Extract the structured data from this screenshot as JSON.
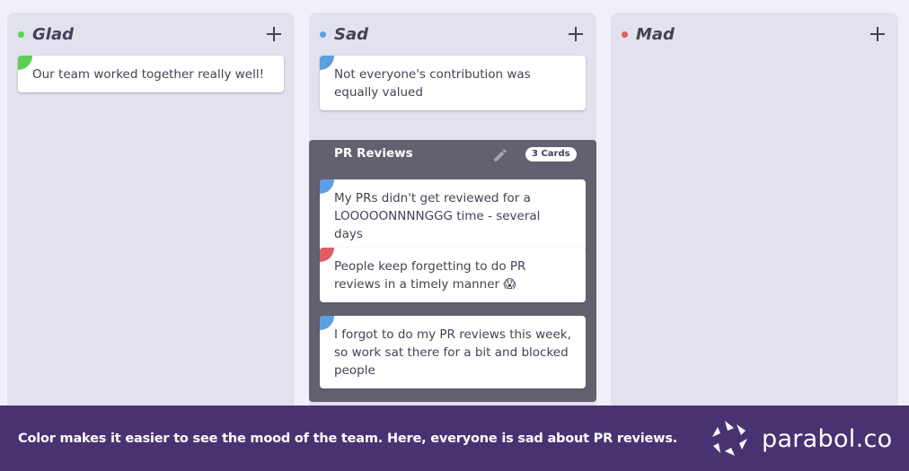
{
  "columns": [
    {
      "title": "Glad",
      "color": "#5ece55",
      "add_label": "+",
      "cards": [
        {
          "text": "Our team worked together really well!",
          "color": "#5ece55"
        }
      ]
    },
    {
      "title": "Sad",
      "color": "#5c9fe2",
      "add_label": "+",
      "cards": [
        {
          "text": "Not everyone's contribution was equally valued",
          "color": "#5c9fe2"
        }
      ],
      "group": {
        "title": "PR Reviews",
        "badge": "3 Cards",
        "cards": [
          {
            "text": "My PRs didn't get reviewed for a LOOOOONNNNGGG time - several days",
            "color": "#5c9fe2"
          },
          {
            "text": "People keep forgetting to do PR reviews in a timely manner 😱",
            "color": "#e25c63"
          },
          {
            "text": "I forgot to do my PR reviews this week, so work sat there for a bit and blocked people",
            "color": "#5c9fe2"
          }
        ]
      }
    },
    {
      "title": "Mad",
      "color": "#e25c63",
      "add_label": "+",
      "cards": []
    }
  ],
  "banner": {
    "text": "Color makes it easier to see the mood of the team. Here, everyone is sad about PR reviews.",
    "logo_text": "parabol.co",
    "background": "#493272"
  }
}
